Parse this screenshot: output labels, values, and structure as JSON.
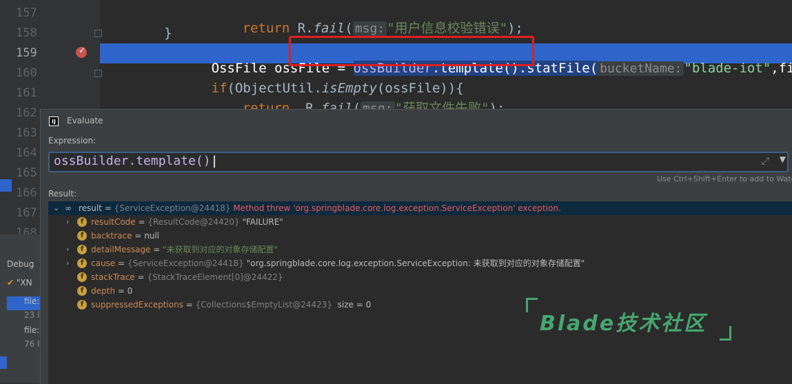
{
  "editor": {
    "lines": [
      {
        "num": "157"
      },
      {
        "num": "158"
      },
      {
        "num": "159"
      },
      {
        "num": "160"
      },
      {
        "num": "161"
      },
      {
        "num": "162"
      },
      {
        "num": "163"
      },
      {
        "num": "164"
      },
      {
        "num": "165"
      },
      {
        "num": "166"
      },
      {
        "num": "167"
      },
      {
        "num": "168"
      }
    ],
    "code": {
      "l157_return": "return",
      "l157_call": " R.",
      "l157_fail": "fail",
      "l157_open": "(",
      "l157_hint": "msg:",
      "l157_str": "\"用户信息校验错误\"",
      "l157_close": ");",
      "l158_brace": "}",
      "l159_decl": "OssFile ossFile = ",
      "l159_builder": "ossBuilder",
      "l159_template": ".template()",
      "l159_stat": ".statFile(",
      "l159_hint": "bucketName:",
      "l159_str": "\"blade-iot\"",
      "l159_rest": ",fileCode);",
      "l160_if": "if",
      "l160_open": "(ObjectUtil.",
      "l160_isempty": "isEmpty",
      "l160_rest": "(ossFile)){",
      "l161_return": "return",
      "l161_call": "  R.",
      "l161_fail": "fail",
      "l161_open": "(",
      "l161_hint": "msg:",
      "l161_str": "\"获取文件失败\"",
      "l161_close": ");"
    }
  },
  "debug_panel": {
    "tab_label": "Debug",
    "frame_label": "\"XN",
    "rows": [
      "file:",
      "23 l",
      "file:",
      "76 l"
    ]
  },
  "evaluate": {
    "title": "Evaluate",
    "icon_label": "IJ",
    "expression_label": "Expression:",
    "expression": "ossBuilder.template()",
    "hint": "Use Ctrl+Shift+Enter to add to Watche",
    "result_label": "Result:",
    "result": {
      "name": "result",
      "type": "{ServiceException@24418}",
      "message": "Method threw 'org.springblade.core.log.exception.ServiceException' exception."
    },
    "fields": [
      {
        "name": "resultCode",
        "type": "{ResultCode@24420}",
        "value": "\"FAILURE\""
      },
      {
        "name": "backtrace",
        "type": "",
        "value": "null"
      },
      {
        "name": "detailMessage",
        "type": "",
        "value": "\"未获取到对应的对象存储配置\""
      },
      {
        "name": "cause",
        "type": "{ServiceException@24418}",
        "value": "\"org.springblade.core.log.exception.ServiceException: 未获取到对应的对象存储配置\""
      },
      {
        "name": "stackTrace",
        "type": "{StackTraceElement[0]@24422}",
        "value": ""
      },
      {
        "name": "depth",
        "type": "",
        "value": "0"
      },
      {
        "name": "suppressedExceptions",
        "type": "{Collections$EmptyList@24423}",
        "value": "size = 0"
      }
    ]
  },
  "watermark": {
    "text": "Blade技术社区",
    "color": "#46a66f"
  },
  "colors": {
    "keyword": "#cc7832",
    "string": "#6a8759",
    "error": "#ef5a5a",
    "field": "#c98a56",
    "highlight": "#2f65ca"
  }
}
